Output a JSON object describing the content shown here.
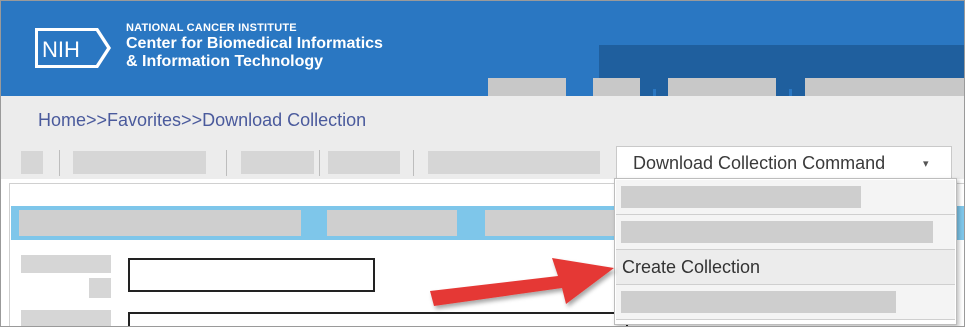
{
  "header": {
    "logo_text": "NIH",
    "org_line1": "NATIONAL CANCER INSTITUTE",
    "org_line2": "Center for Biomedical Informatics",
    "org_line3": "& Information Technology",
    "brand_color": "#2a77c2"
  },
  "breadcrumb": "Home>>Favorites>>Download Collection",
  "toolbar": {
    "download_command_label": "Download Collection Command",
    "chevron": "▾"
  },
  "dropdown": {
    "items": [
      "",
      "",
      "Create Collection",
      ""
    ],
    "highlighted": "Create Collection"
  },
  "annotation": {
    "arrow_color": "#e53935"
  }
}
